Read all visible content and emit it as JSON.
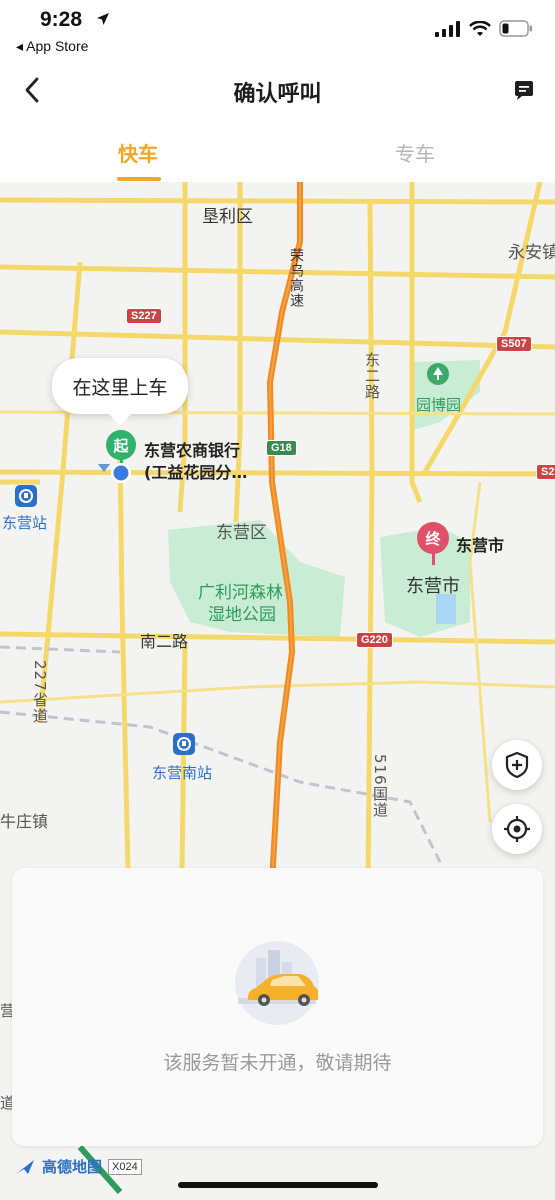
{
  "status_bar": {
    "time": "9:28",
    "back_app": "◂ App Store"
  },
  "nav": {
    "title": "确认呼叫"
  },
  "tabs": [
    {
      "label": "快车",
      "active": true
    },
    {
      "label": "专车",
      "active": false
    }
  ],
  "map": {
    "labels": {
      "kenli": "垦利区",
      "yongan": "永安镇",
      "rongwu": "荣乌高速",
      "dongerlu": "东二路",
      "yuanboyuan": "园博园",
      "dongying_station": "东营站",
      "dongying_district": "东营区",
      "forest_park_1": "广利河森林",
      "forest_park_2": "湿地公园",
      "nan_er_lu": "南二路",
      "city": "东营市",
      "provincial_227": "227省道",
      "south_station": "东营南站",
      "national_516": "516国道",
      "niuzhuang": "牛庄镇",
      "edge_1": "营",
      "edge_2": "道"
    },
    "shields": {
      "s227": "S227",
      "s507": "S507",
      "g18": "G18",
      "s2": "S2",
      "g220": "G220"
    },
    "pickup_bubble": "在这里上车",
    "start_pin": "起",
    "end_pin": "终",
    "start_label_line1": "东营农商银行",
    "start_label_line2": "(工益花园分…",
    "end_label": "东营市"
  },
  "panel": {
    "message": "该服务暂未开通，敬请期待"
  },
  "brand": {
    "name": "高德地图",
    "code": "X024"
  },
  "colors": {
    "accent": "#f5a623",
    "highway": "#f08a1c",
    "road": "#f5d86a",
    "park": "#c8ecd4",
    "start": "#2fb26a",
    "end": "#e0506a"
  }
}
